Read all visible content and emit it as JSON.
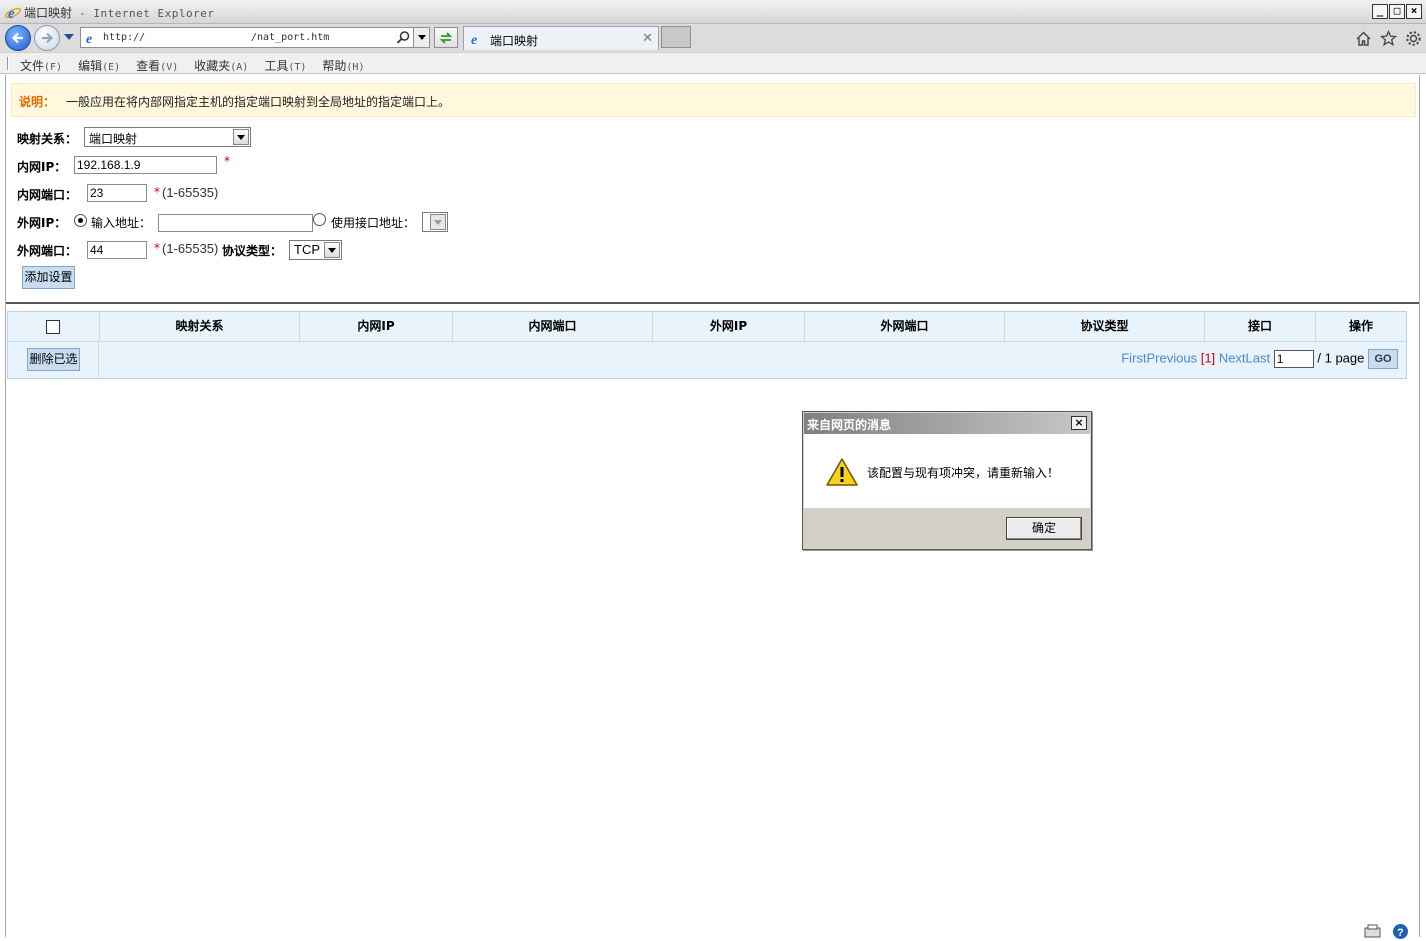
{
  "window": {
    "title": "端口映射",
    "app_name": " - Internet Explorer"
  },
  "nav": {
    "url_prefix": "http://",
    "url_path": "/nat_port.htm",
    "tab_title": "端口映射"
  },
  "menu": {
    "items": [
      {
        "label": "文件",
        "accel": "(F)"
      },
      {
        "label": "编辑",
        "accel": "(E)"
      },
      {
        "label": "查看",
        "accel": "(V)"
      },
      {
        "label": "收藏夹",
        "accel": "(A)"
      },
      {
        "label": "工具",
        "accel": "(T)"
      },
      {
        "label": "帮助",
        "accel": "(H)"
      }
    ]
  },
  "notice": {
    "label": "说明：",
    "text": "一般应用在将内部网指定主机的指定端口映射到全局地址的指定端口上。"
  },
  "form": {
    "mapping_label": "映射关系：",
    "mapping_value": "端口映射",
    "inner_ip_label": "内网IP：",
    "inner_ip_value": "192.168.1.9",
    "inner_port_label": "内网端口：",
    "inner_port_value": "23",
    "port_range_hint": "(1-65535)",
    "required_mark": "*",
    "outer_ip_label": "外网IP：",
    "radio_input_label": "输入地址：",
    "radio_iface_label": "使用接口地址：",
    "outer_port_label": "外网端口：",
    "outer_port_value": "44",
    "protocol_label": "协议类型：",
    "protocol_value": "TCP",
    "add_button": "添加设置"
  },
  "table": {
    "headers": [
      "映射关系",
      "内网IP",
      "内网端口",
      "外网IP",
      "外网端口",
      "协议类型",
      "接口",
      "操作"
    ],
    "delete_button": "删除已选",
    "pager": {
      "first": "First",
      "previous": "Previous",
      "current": "[1]",
      "next": "Next",
      "last": "Last",
      "page_value": "1",
      "total": "/ 1 page",
      "go": "GO"
    }
  },
  "dialog": {
    "title": "来自网页的消息",
    "message": "该配置与现有项冲突，请重新输入！",
    "ok": "确定"
  }
}
